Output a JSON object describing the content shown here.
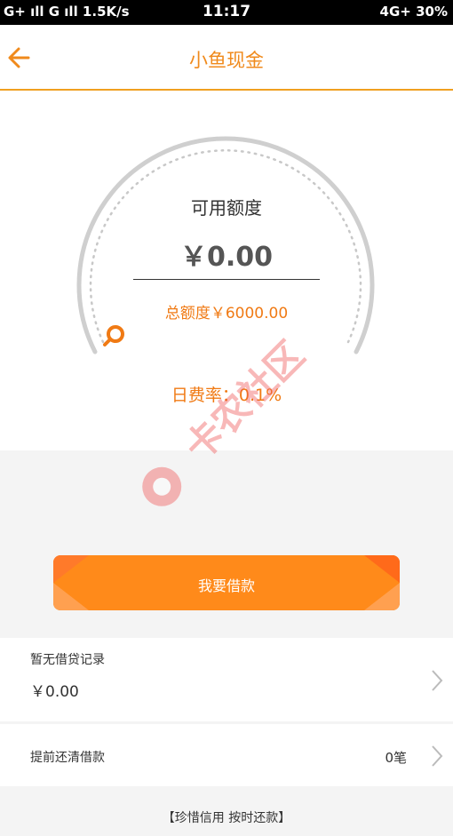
{
  "status_bar": {
    "left": "G+ ıll  G ıll  1.5K/s",
    "time": "11:17",
    "right": "4G+  30%"
  },
  "header": {
    "title": "小鱼现金",
    "accent": "#f08a1c"
  },
  "credit": {
    "available_label": "可用额度",
    "available_amount": "￥0.00",
    "total_label": "总额度￥6000.00",
    "daily_rate": "日费率：0.1%"
  },
  "actions": {
    "borrow_label": "我要借款"
  },
  "loan_record": {
    "title": "暂无借贷记录",
    "amount": "￥0.00"
  },
  "early_repay": {
    "label": "提前还清借款",
    "count": "0笔"
  },
  "footer": {
    "slogan": "【珍惜信用  按时还款】"
  },
  "watermark": {
    "text": "卡农社区"
  }
}
